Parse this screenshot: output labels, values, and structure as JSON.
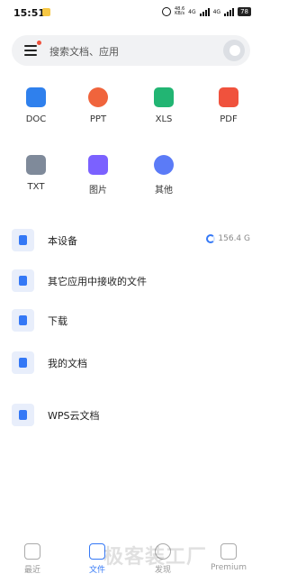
{
  "statusbar": {
    "time": "15:51",
    "net_speed": "48.6",
    "net_unit": "KB/s",
    "net1": "4G",
    "net2": "4G",
    "battery": "78"
  },
  "search": {
    "placeholder": "搜索文档、应用"
  },
  "file_types": [
    {
      "label": "DOC",
      "color": "#2f80ed"
    },
    {
      "label": "PPT",
      "color": "#f0643c"
    },
    {
      "label": "XLS",
      "color": "#22b573"
    },
    {
      "label": "PDF",
      "color": "#f0523d"
    },
    {
      "label": "TXT",
      "color": "#7f8a9a"
    },
    {
      "label": "图片",
      "color": "#7b61ff"
    },
    {
      "label": "其他",
      "color": "#5b7bf7"
    }
  ],
  "locations": [
    {
      "label": "本设备",
      "storage": "156.4 G"
    },
    {
      "label": "其它应用中接收的文件"
    },
    {
      "label": "下载"
    },
    {
      "label": "我的文档"
    },
    {
      "label": "WPS云文档"
    }
  ],
  "tabs": [
    {
      "label": "最近"
    },
    {
      "label": "文件"
    },
    {
      "label": "发现"
    },
    {
      "label": "Premium"
    }
  ],
  "watermark": "极客装工厂",
  "accent": "#3478f6"
}
